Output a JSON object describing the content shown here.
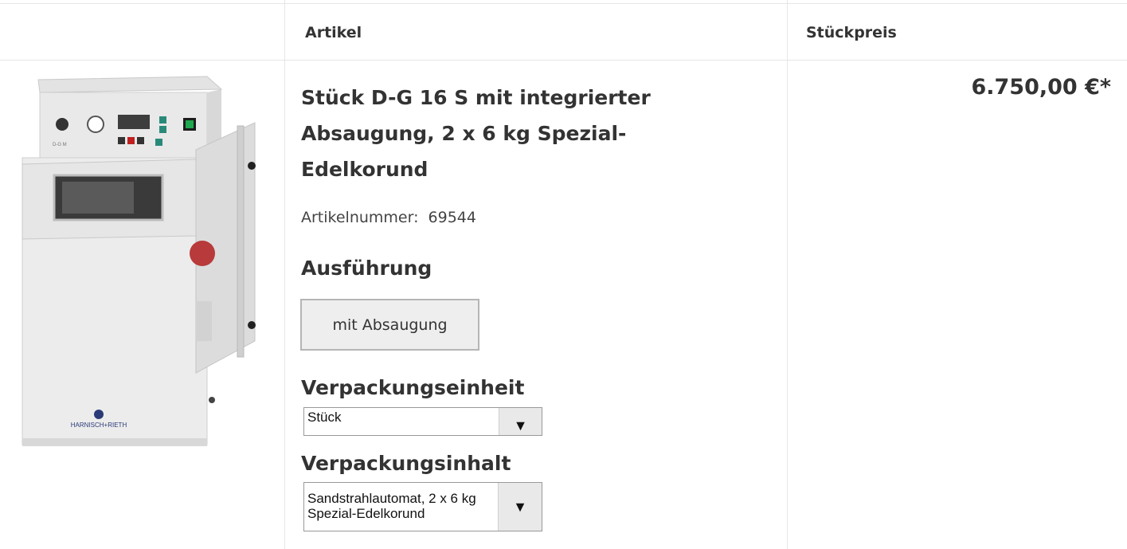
{
  "table": {
    "header": {
      "image_col": "",
      "article_col": "Artikel",
      "price_col": "Stückpreis"
    }
  },
  "product": {
    "title": "Stück D-G 16 S mit integrierter Absaugung, 2 x 6 kg Spezial-Edelkorund",
    "article_number_label": "Artikelnummer:",
    "article_number": "69544",
    "variant_heading": "Ausführung",
    "variant_option": "mit Absaugung",
    "packaging_unit_heading": "Verpackungseinheit",
    "packaging_unit_value": "Stück",
    "packaging_content_heading": "Verpackungsinhalt",
    "packaging_content_value": "Sandstrahlautomat, 2 x 6 kg Spezial-Edelkorund",
    "price": "6.750,00 €*",
    "image_brand": "HARNISCH+RIETH",
    "image_model": "D-G M"
  },
  "icons": {
    "select_arrow": "▼"
  },
  "colors": {
    "border": "#e6e6e6",
    "button_bg": "#eeeeee",
    "text": "#333333"
  }
}
